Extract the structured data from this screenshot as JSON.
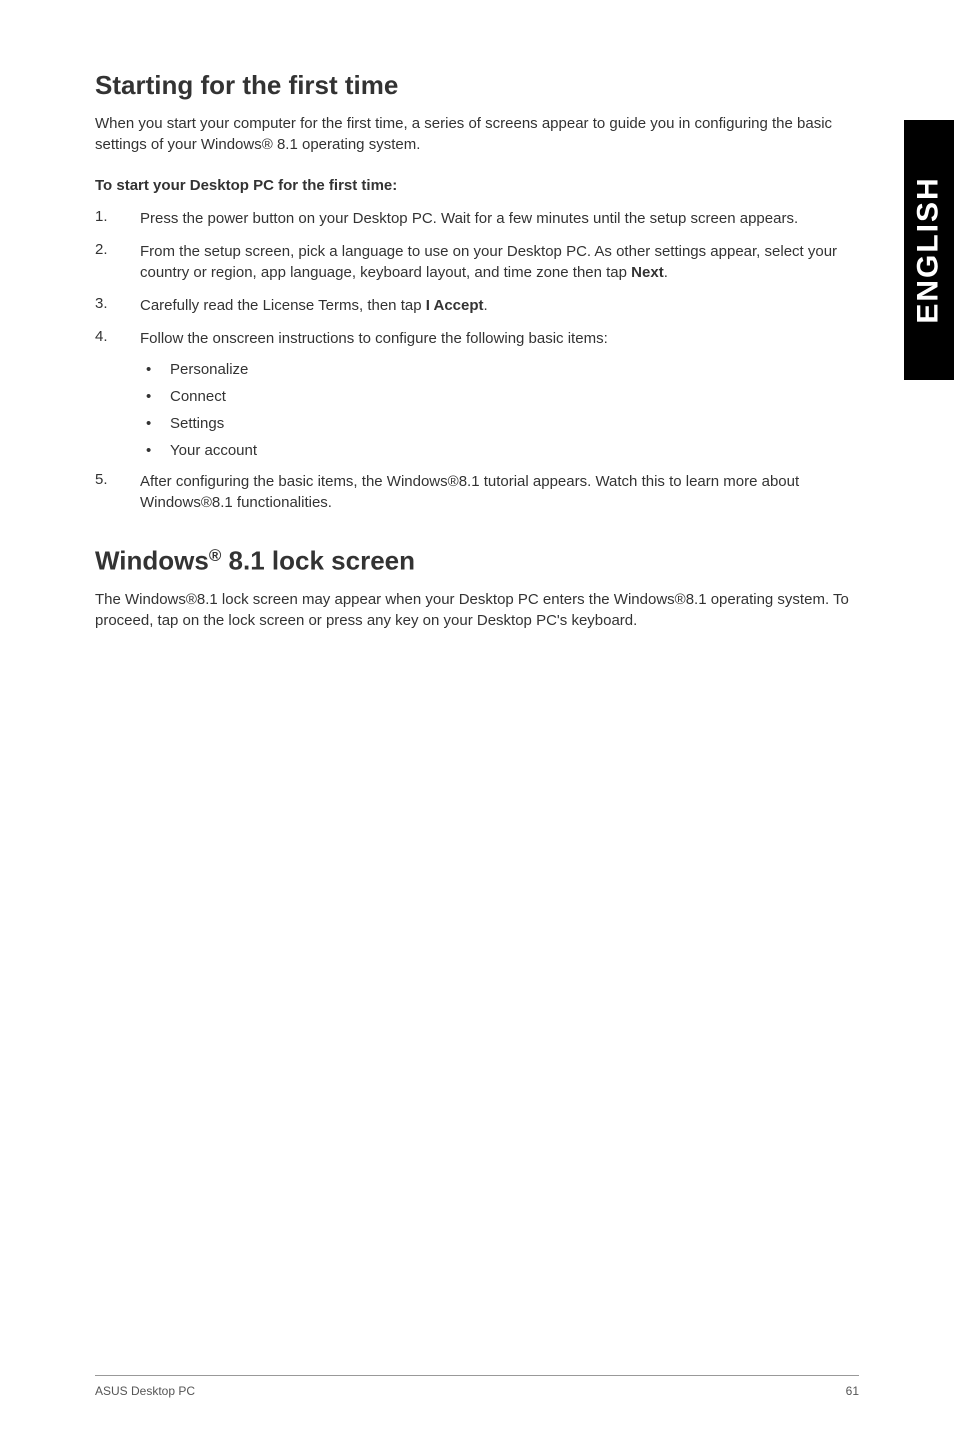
{
  "sideTab": "ENGLISH",
  "section1": {
    "heading": "Starting for the first time",
    "intro": "When you start your computer for the first time, a series of screens appear to guide you in configuring the basic settings of your Windows® 8.1 operating system.",
    "sub": "To start your Desktop PC for the first time:",
    "steps": {
      "s1_num": "1.",
      "s1_text": "Press the power button on your Desktop PC. Wait for a few minutes until the setup screen appears.",
      "s2_num": "2.",
      "s2_pre": "From the setup screen, pick a language to use on your Desktop PC. As other settings appear, select your country or region, app language, keyboard layout, and time zone then tap ",
      "s2_bold": "Next",
      "s2_post": ".",
      "s3_num": "3.",
      "s3_pre": "Carefully read the License Terms, then tap ",
      "s3_bold": "I Accept",
      "s3_post": ".",
      "s4_num": "4.",
      "s4_text": "Follow the onscreen instructions to configure the following basic items:",
      "bullets": {
        "b1": "Personalize",
        "b2": "Connect",
        "b3": "Settings",
        "b4": "Your account"
      },
      "s5_num": "5.",
      "s5_text": "After configuring the basic items, the Windows®8.1 tutorial appears. Watch this to learn more about Windows®8.1 functionalities."
    }
  },
  "section2": {
    "heading_pre": "Windows",
    "heading_reg": "®",
    "heading_post": " 8.1 lock screen",
    "intro": "The Windows®8.1 lock screen may appear when your Desktop PC enters the Windows®8.1 operating system. To proceed,  tap on the lock screen or press any key on your Desktop PC's keyboard."
  },
  "footer": {
    "left": "ASUS Desktop PC",
    "right": "61"
  }
}
